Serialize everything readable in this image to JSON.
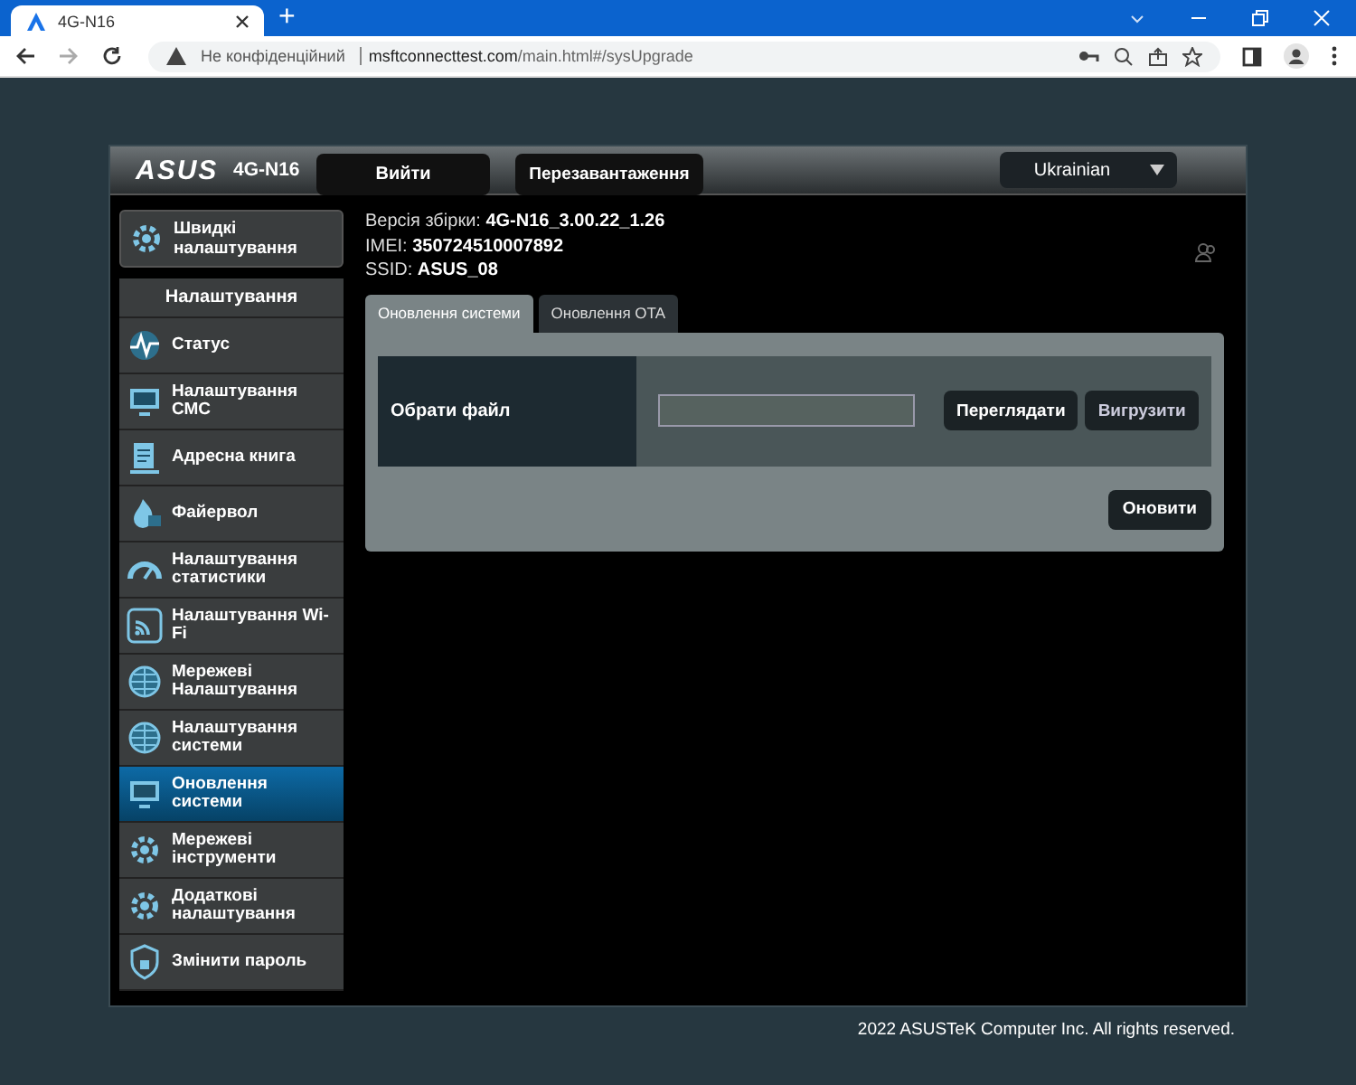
{
  "browser": {
    "tab_title": "4G-N16",
    "new_tab": "+",
    "security": "Не конфіденційний",
    "url_host": "msftconnecttest.com",
    "url_path": "/main.html#/sysUpgrade"
  },
  "header": {
    "logo": "ASUS",
    "model": "4G-N16",
    "buttons": [
      "Вийти",
      "Перезавантаження"
    ],
    "language": "Ukrainian"
  },
  "info": [
    {
      "label": "Версія збірки:",
      "value": "4G-N16_3.00.22_1.26"
    },
    {
      "label": "IMEI:",
      "value": "350724510007892"
    },
    {
      "label": "SSID:",
      "value": "ASUS_08"
    }
  ],
  "quick_setup": {
    "label": "Швидкі налаштування"
  },
  "menu_title": "Налаштування",
  "menu": [
    {
      "label": "Статус",
      "selected": false
    },
    {
      "label": "Налаштування СМС",
      "selected": false
    },
    {
      "label": "Адресна книга",
      "selected": false
    },
    {
      "label": "Файервол",
      "selected": false
    },
    {
      "label": "Налаштування статистики",
      "selected": false
    },
    {
      "label": "Налаштування Wi-Fi",
      "selected": false
    },
    {
      "label": "Мережеві Налаштування",
      "selected": false
    },
    {
      "label": "Налаштування системи",
      "selected": false
    },
    {
      "label": "Оновлення системи",
      "selected": true
    },
    {
      "label": "Мережеві інструменти",
      "selected": false
    },
    {
      "label": "Додаткові налаштування",
      "selected": false
    },
    {
      "label": "Змінити пароль",
      "selected": false
    }
  ],
  "tabs": [
    {
      "label": "Оновлення системи",
      "selected": true
    },
    {
      "label": "Оновлення OTA",
      "selected": false
    }
  ],
  "form": {
    "label": "Обрати файл",
    "buttons": [
      "Переглядати",
      "Вигрузити"
    ],
    "submit": "Оновити"
  },
  "footer": "2022 ASUSTeK Computer Inc. All rights reserved."
}
